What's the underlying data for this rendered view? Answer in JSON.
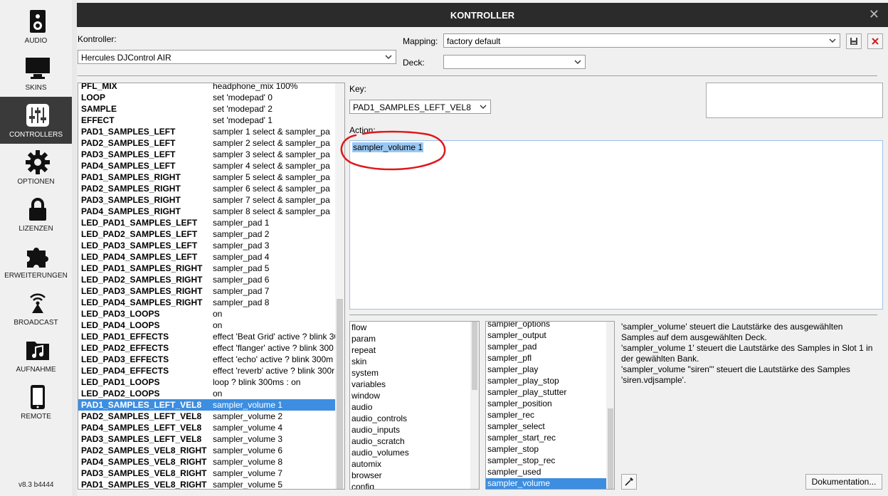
{
  "sidebar": {
    "items": [
      {
        "label": "AUDIO",
        "icon": "speaker-icon"
      },
      {
        "label": "SKINS",
        "icon": "monitor-icon"
      },
      {
        "label": "CONTROLLERS",
        "icon": "sliders-icon",
        "active": true
      },
      {
        "label": "OPTIONEN",
        "icon": "gear-icon"
      },
      {
        "label": "LIZENZEN",
        "icon": "lock-icon"
      },
      {
        "label": "ERWEITERUNGEN",
        "icon": "puzzle-icon"
      },
      {
        "label": "BROADCAST",
        "icon": "broadcast-icon"
      },
      {
        "label": "AUFNAHME",
        "icon": "music-folder-icon"
      },
      {
        "label": "REMOTE",
        "icon": "phone-icon"
      }
    ],
    "version": "v8.3 b4444"
  },
  "window": {
    "title": "KONTROLLER",
    "close": "✕"
  },
  "controller": {
    "label": "Kontroller:",
    "value": "Hercules DJControl AIR"
  },
  "mapping": {
    "label": "Mapping:",
    "value": "factory default"
  },
  "deck": {
    "label": "Deck:",
    "value": ""
  },
  "key": {
    "label": "Key:",
    "value": "PAD1_SAMPLES_LEFT_VEL8"
  },
  "action": {
    "label": "Action:",
    "value": "sampler_volume 1"
  },
  "mappings": [
    {
      "key": "PFL_MIX",
      "action": "headphone_mix 100%"
    },
    {
      "key": "LOOP",
      "action": "set 'modepad' 0"
    },
    {
      "key": "SAMPLE",
      "action": "set 'modepad' 2"
    },
    {
      "key": "EFFECT",
      "action": "set 'modepad' 1"
    },
    {
      "key": "PAD1_SAMPLES_LEFT",
      "action": "sampler 1 select & sampler_pa"
    },
    {
      "key": "PAD2_SAMPLES_LEFT",
      "action": "sampler 2 select & sampler_pa"
    },
    {
      "key": "PAD3_SAMPLES_LEFT",
      "action": "sampler 3 select & sampler_pa"
    },
    {
      "key": "PAD4_SAMPLES_LEFT",
      "action": "sampler 4 select & sampler_pa"
    },
    {
      "key": "PAD1_SAMPLES_RIGHT",
      "action": "sampler 5 select & sampler_pa"
    },
    {
      "key": "PAD2_SAMPLES_RIGHT",
      "action": "sampler 6 select & sampler_pa"
    },
    {
      "key": "PAD3_SAMPLES_RIGHT",
      "action": "sampler 7 select & sampler_pa"
    },
    {
      "key": "PAD4_SAMPLES_RIGHT",
      "action": "sampler 8 select & sampler_pa"
    },
    {
      "key": "LED_PAD1_SAMPLES_LEFT",
      "action": "sampler_pad 1"
    },
    {
      "key": "LED_PAD2_SAMPLES_LEFT",
      "action": "sampler_pad 2"
    },
    {
      "key": "LED_PAD3_SAMPLES_LEFT",
      "action": "sampler_pad 3"
    },
    {
      "key": "LED_PAD4_SAMPLES_LEFT",
      "action": "sampler_pad 4"
    },
    {
      "key": "LED_PAD1_SAMPLES_RIGHT",
      "action": "sampler_pad 5"
    },
    {
      "key": "LED_PAD2_SAMPLES_RIGHT",
      "action": "sampler_pad 6"
    },
    {
      "key": "LED_PAD3_SAMPLES_RIGHT",
      "action": "sampler_pad 7"
    },
    {
      "key": "LED_PAD4_SAMPLES_RIGHT",
      "action": "sampler_pad 8"
    },
    {
      "key": "LED_PAD3_LOOPS",
      "action": "on"
    },
    {
      "key": "LED_PAD4_LOOPS",
      "action": "on"
    },
    {
      "key": "LED_PAD1_EFFECTS",
      "action": "effect 'Beat Grid' active ? blink 30"
    },
    {
      "key": "LED_PAD2_EFFECTS",
      "action": "effect 'flanger' active ? blink 300"
    },
    {
      "key": "LED_PAD3_EFFECTS",
      "action": "effect 'echo' active ? blink 300m"
    },
    {
      "key": "LED_PAD4_EFFECTS",
      "action": "effect 'reverb' active ? blink 300r"
    },
    {
      "key": "LED_PAD1_LOOPS",
      "action": "loop ? blink 300ms : on"
    },
    {
      "key": "LED_PAD2_LOOPS",
      "action": "on"
    },
    {
      "key": "PAD1_SAMPLES_LEFT_VEL8",
      "action": "sampler_volume 1",
      "selected": true
    },
    {
      "key": "PAD2_SAMPLES_LEFT_VEL8",
      "action": "sampler_volume 2"
    },
    {
      "key": "PAD4_SAMPLES_LEFT_VEL8",
      "action": "sampler_volume 4"
    },
    {
      "key": "PAD3_SAMPLES_LEFT_VEL8",
      "action": "sampler_volume 3"
    },
    {
      "key": "PAD2_SAMPLES_VEL8_RIGHT",
      "action": "sampler_volume 6"
    },
    {
      "key": "PAD4_SAMPLES_VEL8_RIGHT",
      "action": "sampler_volume 8"
    },
    {
      "key": "PAD3_SAMPLES_VEL8_RIGHT",
      "action": "sampler_volume 7"
    },
    {
      "key": "PAD1_SAMPLES_VEL8_RIGHT",
      "action": "sampler_volume 5"
    }
  ],
  "categories": [
    "flow",
    "param",
    "repeat",
    "skin",
    "system",
    "variables",
    "window",
    "audio",
    "audio_controls",
    "audio_inputs",
    "audio_scratch",
    "audio_volumes",
    "automix",
    "browser",
    "config"
  ],
  "verbs": [
    {
      "label": "sampler_options"
    },
    {
      "label": "sampler_output"
    },
    {
      "label": "sampler_pad"
    },
    {
      "label": "sampler_pfl"
    },
    {
      "label": "sampler_play"
    },
    {
      "label": "sampler_play_stop"
    },
    {
      "label": "sampler_play_stutter"
    },
    {
      "label": "sampler_position"
    },
    {
      "label": "sampler_rec"
    },
    {
      "label": "sampler_select"
    },
    {
      "label": "sampler_start_rec"
    },
    {
      "label": "sampler_stop"
    },
    {
      "label": "sampler_stop_rec"
    },
    {
      "label": "sampler_used"
    },
    {
      "label": "sampler_volume",
      "selected": true
    }
  ],
  "documentation": {
    "lines": [
      "'sampler_volume' steuert die Lautstärke des ausgewählten",
      "Samples auf dem ausgewählten Deck.",
      "'sampler_volume 1' steuert die Lautstärke des Samples in Slot 1 in",
      "der gewählten Bank.",
      "'sampler_volume \"siren\"' steuert die Lautstärke des Samples",
      "'siren.vdjsample'."
    ],
    "button": "Dokumentation..."
  },
  "colors": {
    "selection": "#3d8ee0",
    "titlebar": "#2b2b2b",
    "active_sidebar": "#3a3a3a",
    "annotation": "#e0171b"
  }
}
